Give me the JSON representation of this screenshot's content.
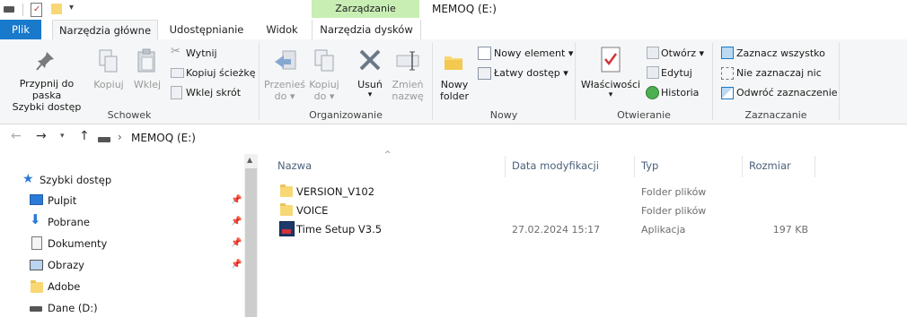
{
  "title_bar": {
    "context_tab_group": "Zarządzanie",
    "window_title": "MEMOQ (E:)"
  },
  "tabs": {
    "file": "Plik",
    "home": "Narzędzia główne",
    "share": "Udostępnianie",
    "view": "Widok",
    "drive_tools": "Narzędzia dysków"
  },
  "ribbon": {
    "clipboard": {
      "group": "Schowek",
      "pin_line1": "Przypnij do paska",
      "pin_line2": "Szybki dostęp",
      "copy": "Kopiuj",
      "paste": "Wklej",
      "cut": "Wytnij",
      "copy_path": "Kopiuj ścieżkę",
      "paste_shortcut": "Wklej skrót"
    },
    "organize": {
      "group": "Organizowanie",
      "move_line1": "Przenieś",
      "move_line2": "do ▾",
      "copy_line1": "Kopiuj",
      "copy_line2": "do ▾",
      "delete": "Usuń",
      "delete_arrow": "▾",
      "rename_line1": "Zmień",
      "rename_line2": "nazwę"
    },
    "new": {
      "group": "Nowy",
      "folder_line1": "Nowy",
      "folder_line2": "folder",
      "new_item": "Nowy element ▾",
      "easy_access": "Łatwy dostęp ▾"
    },
    "open": {
      "group": "Otwieranie",
      "properties": "Właściwości",
      "properties_arrow": "▾",
      "open": "Otwórz ▾",
      "edit": "Edytuj",
      "history": "Historia"
    },
    "select": {
      "group": "Zaznaczanie",
      "select_all": "Zaznacz wszystko",
      "select_none": "Nie zaznaczaj nic",
      "invert": "Odwróć zaznaczenie"
    }
  },
  "address": {
    "path": "MEMOQ (E:)",
    "separator": "›"
  },
  "nav_pane": {
    "quick_access": "Szybki dostęp",
    "items": [
      {
        "label": "Pulpit",
        "pinned": true
      },
      {
        "label": "Pobrane",
        "pinned": true
      },
      {
        "label": "Dokumenty",
        "pinned": true
      },
      {
        "label": "Obrazy",
        "pinned": true
      },
      {
        "label": "Adobe",
        "pinned": false
      },
      {
        "label": "Dane (D:)",
        "pinned": false
      }
    ]
  },
  "file_list": {
    "columns": [
      "Nazwa",
      "Data modyfikacji",
      "Typ",
      "Rozmiar"
    ],
    "rows": [
      {
        "name": "VERSION_V102",
        "date": "",
        "type": "Folder plików",
        "size": ""
      },
      {
        "name": "VOICE",
        "date": "",
        "type": "Folder plików",
        "size": ""
      },
      {
        "name": "Time Setup V3.5",
        "date": "27.02.2024 15:17",
        "type": "Aplikacja",
        "size": "197 KB"
      }
    ]
  },
  "colors": {
    "file_tab": "#1979ca",
    "context_band": "#c9eeb4",
    "folder": "#f8d775",
    "header_text": "#4c607a"
  }
}
